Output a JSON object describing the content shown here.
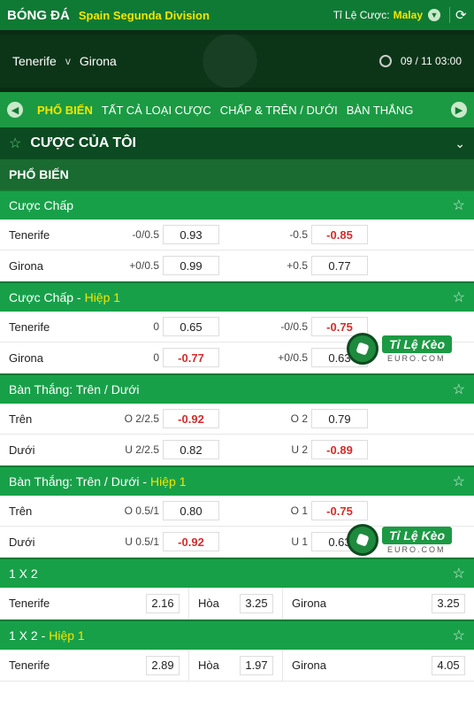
{
  "header": {
    "brand": "BÓNG ĐÁ",
    "league": "Spain Segunda Division",
    "odds_type_label": "Tỉ Lệ Cược:",
    "odds_type_value": "Malay"
  },
  "match": {
    "home": "Tenerife",
    "vs": "v",
    "away": "Girona",
    "datetime": "09 / 11  03:00"
  },
  "tabs": [
    "PHỔ BIẾN",
    "TẤT CẢ LOẠI CƯỢC",
    "CHẤP & TRÊN / DƯỚI",
    "BÀN THẮNG"
  ],
  "my_bets": {
    "title": "CƯỢC CỦA TÔI"
  },
  "section": {
    "title": "PHỔ BIẾN"
  },
  "markets": {
    "handicap": {
      "title": "Cược Chấp",
      "highlight": "",
      "rows": [
        {
          "name": "Tenerife",
          "hc1": "-0/0.5",
          "o1": "0.93",
          "hc2": "-0.5",
          "o2": "-0.85"
        },
        {
          "name": "Girona",
          "hc1": "+0/0.5",
          "o1": "0.99",
          "hc2": "+0.5",
          "o2": "0.77"
        }
      ]
    },
    "handicap_h1": {
      "title": "Cược Chấp -",
      "highlight": "Hiệp 1",
      "rows": [
        {
          "name": "Tenerife",
          "hc1": "0",
          "o1": "0.65",
          "hc2": "-0/0.5",
          "o2": "-0.75"
        },
        {
          "name": "Girona",
          "hc1": "0",
          "o1": "-0.77",
          "hc2": "+0/0.5",
          "o2": "0.63"
        }
      ]
    },
    "ou": {
      "title": "Bàn Thắng: Trên / Dưới",
      "highlight": "",
      "rows": [
        {
          "name": "Trên",
          "hc1": "O  2/2.5",
          "o1": "-0.92",
          "hc2": "O  2",
          "o2": "0.79"
        },
        {
          "name": "Dưới",
          "hc1": "U  2/2.5",
          "o1": "0.82",
          "hc2": "U  2",
          "o2": "-0.89"
        }
      ]
    },
    "ou_h1": {
      "title": "Bàn Thắng: Trên / Dưới -",
      "highlight": "Hiệp 1",
      "rows": [
        {
          "name": "Trên",
          "hc1": "O  0.5/1",
          "o1": "0.80",
          "hc2": "O  1",
          "o2": "-0.75"
        },
        {
          "name": "Dưới",
          "hc1": "U  0.5/1",
          "o1": "-0.92",
          "hc2": "U  1",
          "o2": "0.63"
        }
      ]
    },
    "x12": {
      "title": "1 X 2",
      "highlight": "",
      "home": "Tenerife",
      "home_odds": "2.16",
      "draw": "Hòa",
      "draw_odds": "3.25",
      "away": "Girona",
      "away_odds": "3.25"
    },
    "x12_h1": {
      "title": "1 X 2 -",
      "highlight": "Hiệp 1",
      "home": "Tenerife",
      "home_odds": "2.89",
      "draw": "Hòa",
      "draw_odds": "1.97",
      "away": "Girona",
      "away_odds": "4.05"
    }
  },
  "watermark": {
    "title": "Tỉ Lệ Kèo",
    "sub": "EURO.COM"
  }
}
